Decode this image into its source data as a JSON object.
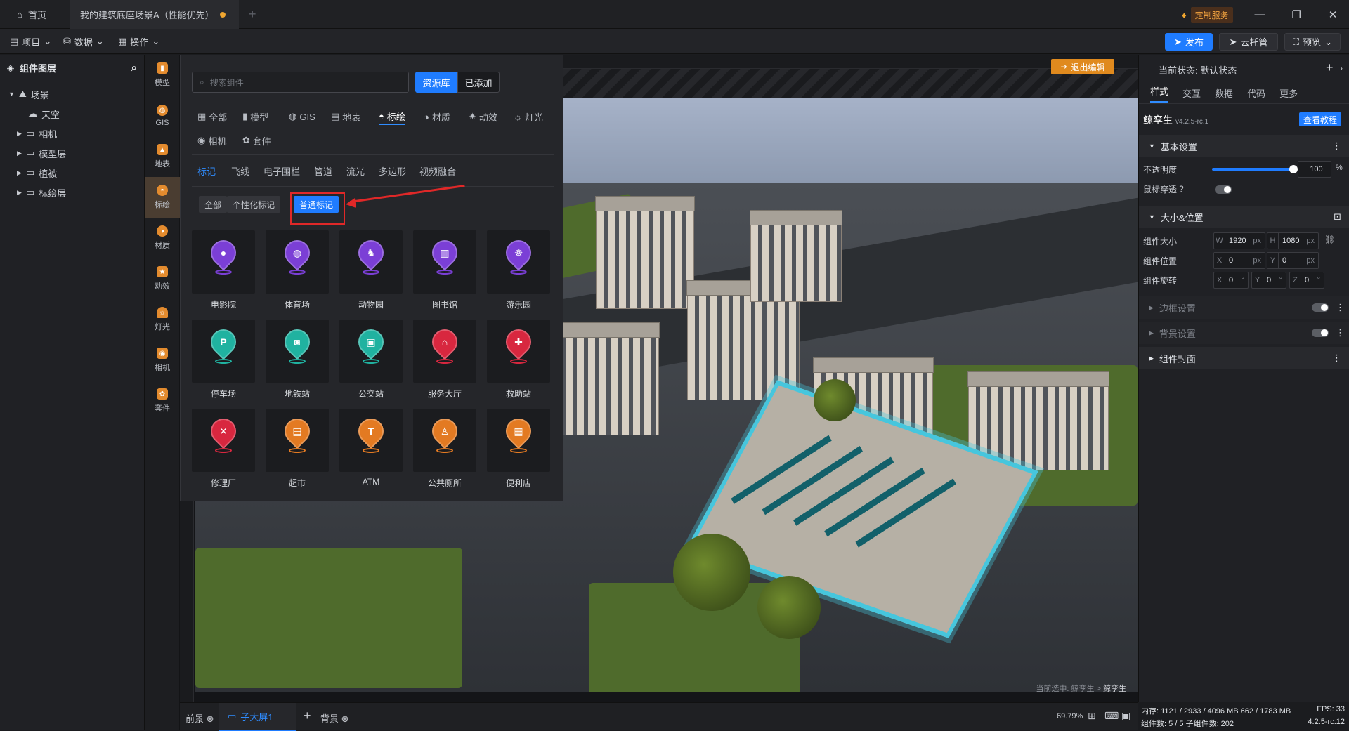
{
  "titlebar": {
    "home_tab": "首页",
    "doc_tab": "我的建筑底座场景A（性能优先）",
    "custom_service": "定制服务"
  },
  "menubar": {
    "project": "项目",
    "data": "数据",
    "operate": "操作",
    "publish": "发布",
    "cloud": "云托管",
    "preview": "预览"
  },
  "layers": {
    "title": "组件图层",
    "items": [
      {
        "label": "场景"
      },
      {
        "label": "天空"
      },
      {
        "label": "相机"
      },
      {
        "label": "模型层"
      },
      {
        "label": "植被"
      },
      {
        "label": "标绘层"
      }
    ]
  },
  "iconbar": [
    "模型",
    "GIS",
    "地表",
    "标绘",
    "材质",
    "动效",
    "灯光",
    "相机",
    "套件"
  ],
  "panel": {
    "search_placeholder": "搜索组件",
    "seg_library": "资源库",
    "seg_added": "已添加",
    "categories": [
      "全部",
      "模型",
      "GIS",
      "地表",
      "标绘",
      "材质",
      "动效",
      "灯光",
      "相机",
      "套件"
    ],
    "subcategories": [
      "标记",
      "飞线",
      "电子围栏",
      "管道",
      "流光",
      "多边形",
      "视频融合"
    ],
    "filters": [
      "全部",
      "个性化标记",
      "普通标记"
    ],
    "cards": [
      {
        "label": "电影院",
        "color": "#7b3fd6",
        "glyph": "●"
      },
      {
        "label": "体育场",
        "color": "#7b3fd6",
        "glyph": "◍"
      },
      {
        "label": "动物园",
        "color": "#7b3fd6",
        "glyph": "♞"
      },
      {
        "label": "图书馆",
        "color": "#7b3fd6",
        "glyph": "▥"
      },
      {
        "label": "游乐园",
        "color": "#7b3fd6",
        "glyph": "☸"
      },
      {
        "label": "停车场",
        "color": "#20b2a0",
        "glyph": "P"
      },
      {
        "label": "地铁站",
        "color": "#20b2a0",
        "glyph": "◙"
      },
      {
        "label": "公交站",
        "color": "#20b2a0",
        "glyph": "▣"
      },
      {
        "label": "服务大厅",
        "color": "#d8273f",
        "glyph": "⌂"
      },
      {
        "label": "救助站",
        "color": "#d8273f",
        "glyph": "✚"
      },
      {
        "label": "修理厂",
        "color": "#d8273f",
        "glyph": "✕"
      },
      {
        "label": "超市",
        "color": "#e37a22",
        "glyph": "▤"
      },
      {
        "label": "ATM",
        "color": "#e37a22",
        "glyph": "T"
      },
      {
        "label": "公共厕所",
        "color": "#e37a22",
        "glyph": "♙"
      },
      {
        "label": "便利店",
        "color": "#e37a22",
        "glyph": "▦"
      }
    ]
  },
  "canvas": {
    "exit_edit": "退出编辑",
    "selection_prefix": "当前选中: 鲸孪生 >",
    "selection_current": "鲸孪生"
  },
  "props": {
    "state_label": "当前状态:",
    "state_value": "默认状态",
    "tabs": [
      "样式",
      "交互",
      "数据",
      "代码",
      "更多"
    ],
    "brand": "鲸孪生",
    "version": "v4.2.5-rc.1",
    "tutorial": "查看教程",
    "sec_basic": "基本设置",
    "opacity_label": "不透明度",
    "opacity_value": "100",
    "opacity_unit": "%",
    "opacity_fraction": 1.0,
    "mouse_label": "鼠标穿透",
    "sec_size": "大小&位置",
    "size_label": "组件大小",
    "w": "1920",
    "h": "1080",
    "pos_label": "组件位置",
    "x": "0",
    "y": "0",
    "rot_label": "组件旋转",
    "rx": "0",
    "ry": "0",
    "rz": "0",
    "sec_border": "边框设置",
    "sec_bg": "背景设置",
    "sec_cover": "组件封面"
  },
  "bottombar": {
    "front": "前景",
    "screen": "子大屏1",
    "back": "背景",
    "zoom": "69.79%"
  },
  "status": {
    "memory": "内存: 1121 / 2933 / 4096 MB  662 / 1783 MB",
    "fps": "FPS: 33",
    "count": "组件数: 5 / 5  子组件数: 202",
    "ver": "4.2.5-rc.12"
  }
}
